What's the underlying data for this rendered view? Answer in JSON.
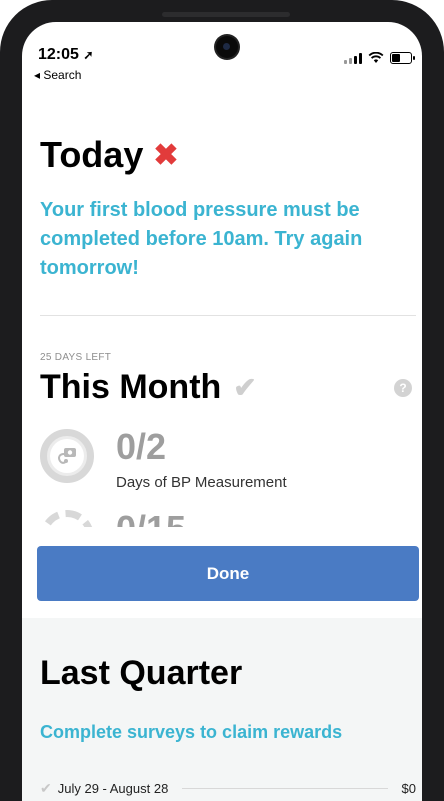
{
  "status_bar": {
    "time": "12:05",
    "back_label": "◂ Search"
  },
  "today": {
    "title": "Today",
    "message": "Your first blood pressure must be completed before 10am. Try again tomorrow!"
  },
  "this_month": {
    "days_left": "25 DAYS LEFT",
    "title": "This Month",
    "help": "?",
    "bp": {
      "value": "0/2",
      "label": "Days of BP Measurement"
    },
    "surveys": {
      "value": "0/15"
    }
  },
  "done_button": "Done",
  "last_quarter": {
    "title": "Last Quarter",
    "subtitle": "Complete surveys to claim rewards",
    "periods": [
      {
        "range": "July 29 - August 28",
        "amount": "$0"
      }
    ]
  },
  "colors": {
    "accent": "#3bb4d1",
    "button": "#4a7bc4",
    "error": "#e23b3b"
  },
  "icons": [
    "location-arrow-icon",
    "signal-icon",
    "wifi-icon",
    "battery-icon",
    "x-icon",
    "check-icon",
    "help-icon",
    "bp-cuff-icon"
  ]
}
